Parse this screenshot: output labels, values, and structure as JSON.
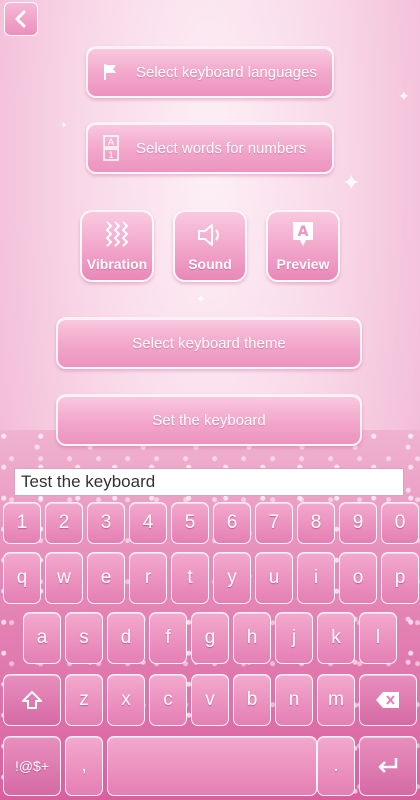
{
  "colors": {
    "accent": "#ec93bf",
    "key": "#e47fb4",
    "text": "#ffffff"
  },
  "back": {
    "icon": "arrow-left-icon"
  },
  "menu": {
    "languages": {
      "label": "Select keyboard languages",
      "icon": "flag-icon"
    },
    "numbers": {
      "label": "Select words for numbers",
      "icon": "a1-icon"
    },
    "theme": {
      "label": "Select keyboard theme"
    },
    "set": {
      "label": "Set the keyboard"
    }
  },
  "toggles": {
    "vibration": {
      "label": "Vibration",
      "icon": "vibration-icon"
    },
    "sound": {
      "label": "Sound",
      "icon": "speaker-icon"
    },
    "preview": {
      "label": "Preview",
      "icon": "preview-icon"
    }
  },
  "test_input": {
    "value": "Test the keyboard"
  },
  "keyboard": {
    "row1": [
      "1",
      "2",
      "3",
      "4",
      "5",
      "6",
      "7",
      "8",
      "9",
      "0"
    ],
    "row2": [
      "q",
      "w",
      "e",
      "r",
      "t",
      "y",
      "u",
      "i",
      "o",
      "p"
    ],
    "row3": [
      "a",
      "s",
      "d",
      "f",
      "g",
      "h",
      "j",
      "k",
      "l"
    ],
    "row4": [
      "z",
      "x",
      "c",
      "v",
      "b",
      "n",
      "m"
    ],
    "symbols": "!@$+",
    "comma": ",",
    "period": ".",
    "shift_icon": "shift-icon",
    "backspace_icon": "backspace-icon",
    "enter_icon": "enter-icon"
  }
}
